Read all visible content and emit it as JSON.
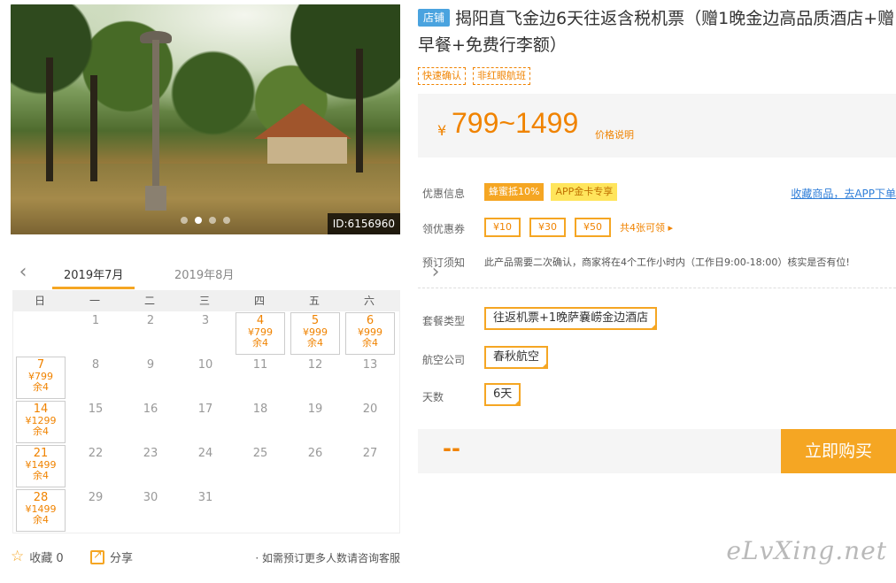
{
  "photo": {
    "id_label": "ID:6156960",
    "dots": 4,
    "active_dot": 1
  },
  "calendar": {
    "months": [
      "2019年7月",
      "2019年8月"
    ],
    "weekdays": [
      "日",
      "一",
      "二",
      "三",
      "四",
      "五",
      "六"
    ],
    "cells": [
      {
        "day": "",
        "price": "",
        "left": ""
      },
      {
        "day": "1",
        "price": "",
        "left": ""
      },
      {
        "day": "2",
        "price": "",
        "left": ""
      },
      {
        "day": "3",
        "price": "",
        "left": ""
      },
      {
        "day": "4",
        "price": "¥799",
        "left": "余4"
      },
      {
        "day": "5",
        "price": "¥999",
        "left": "余4"
      },
      {
        "day": "6",
        "price": "¥999",
        "left": "余4"
      },
      {
        "day": "7",
        "price": "¥799",
        "left": "余4"
      },
      {
        "day": "8",
        "price": "",
        "left": ""
      },
      {
        "day": "9",
        "price": "",
        "left": ""
      },
      {
        "day": "10",
        "price": "",
        "left": ""
      },
      {
        "day": "11",
        "price": "",
        "left": ""
      },
      {
        "day": "12",
        "price": "",
        "left": ""
      },
      {
        "day": "13",
        "price": "",
        "left": ""
      },
      {
        "day": "14",
        "price": "¥1299",
        "left": "余4"
      },
      {
        "day": "15",
        "price": "",
        "left": ""
      },
      {
        "day": "16",
        "price": "",
        "left": ""
      },
      {
        "day": "17",
        "price": "",
        "left": ""
      },
      {
        "day": "18",
        "price": "",
        "left": ""
      },
      {
        "day": "19",
        "price": "",
        "left": ""
      },
      {
        "day": "20",
        "price": "",
        "left": ""
      },
      {
        "day": "21",
        "price": "¥1499",
        "left": "余4"
      },
      {
        "day": "22",
        "price": "",
        "left": ""
      },
      {
        "day": "23",
        "price": "",
        "left": ""
      },
      {
        "day": "24",
        "price": "",
        "left": ""
      },
      {
        "day": "25",
        "price": "",
        "left": ""
      },
      {
        "day": "26",
        "price": "",
        "left": ""
      },
      {
        "day": "27",
        "price": "",
        "left": ""
      },
      {
        "day": "28",
        "price": "¥1499",
        "left": "余4"
      },
      {
        "day": "29",
        "price": "",
        "left": ""
      },
      {
        "day": "30",
        "price": "",
        "left": ""
      },
      {
        "day": "31",
        "price": "",
        "left": ""
      }
    ]
  },
  "footer": {
    "favorite_label": "收藏 0",
    "share_label": "分享",
    "note": "· 如需预订更多人数请咨询客服"
  },
  "product": {
    "shop_tag": "店铺",
    "title": "揭阳直飞金边6天往返含税机票（赠1晚金边高品质酒店+赠早餐+免费行李额）",
    "tags": [
      "快速确认",
      "非红眼航班"
    ],
    "price_symbol": "¥",
    "price_range": "799~1499",
    "price_explain": "价格说明"
  },
  "promo": {
    "label": "优惠信息",
    "badges": [
      "蜂蜜抵10%",
      "APP金卡专享"
    ],
    "link": "收藏商品，去APP下单"
  },
  "coupons": {
    "label": "领优惠券",
    "items": [
      "¥10",
      "¥30",
      "¥50"
    ],
    "more": "共4张可领 ▸"
  },
  "notice": {
    "label": "预订须知",
    "text": "此产品需要二次确认，商家将在4个工作小时内（工作日9:00-18:00）核实是否有位!"
  },
  "options": {
    "package_label": "套餐类型",
    "package_value": "往返机票+1晚萨嚢崂金边酒店",
    "airline_label": "航空公司",
    "airline_value": "春秋航空",
    "days_label": "天数",
    "days_value": "6天"
  },
  "buy": {
    "total": "--",
    "button": "立即购买"
  },
  "watermark": "eLvXing.net",
  "colors": {
    "accent": "#f5a623",
    "price": "#f08300",
    "link": "#2f7ed8",
    "shop_tag": "#4aa3df"
  }
}
